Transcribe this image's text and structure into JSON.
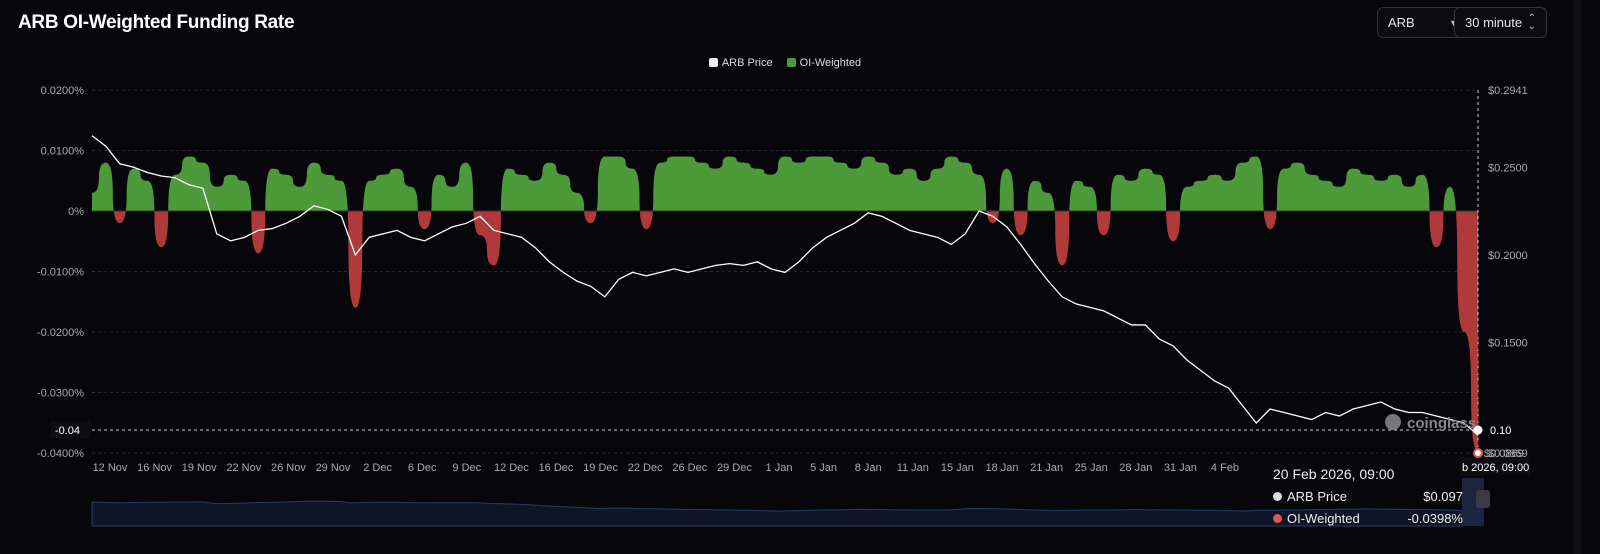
{
  "header": {
    "title": "ARB OI-Weighted Funding Rate",
    "coin_select": "ARB",
    "interval_select": "30 minute"
  },
  "colors": {
    "positive": "#4c9a3a",
    "negative": "#b03a3a",
    "price": "#ffffff",
    "navigator": "#2a3a6a"
  },
  "tooltip": {
    "date": "20 Feb 2026, 09:00",
    "rows": [
      {
        "label": "ARB Price",
        "value": "$0.097",
        "color": "#ffffff"
      },
      {
        "label": "OI-Weighted",
        "value": "-0.0398%",
        "color": "#e05555"
      }
    ]
  },
  "crosshair": {
    "left_label": "-0.04",
    "right_label": "0.10",
    "right_secondary": "$0.0869",
    "bottom_label": "b 2026, 09:00"
  },
  "watermark": "coinglass",
  "chart_data": {
    "type": "bar+line",
    "legend": [
      "ARB Price",
      "OI-Weighted"
    ],
    "legend_position": "top",
    "x_range": [
      "12 Nov 2025",
      "20 Feb 2026"
    ],
    "x_ticks": [
      "12 Nov",
      "16 Nov",
      "19 Nov",
      "22 Nov",
      "26 Nov",
      "29 Nov",
      "2 Dec",
      "6 Dec",
      "9 Dec",
      "12 Dec",
      "16 Dec",
      "19 Dec",
      "22 Dec",
      "26 Dec",
      "29 Dec",
      "1 Jan",
      "5 Jan",
      "8 Jan",
      "11 Jan",
      "15 Jan",
      "18 Jan",
      "21 Jan",
      "25 Jan",
      "28 Jan",
      "31 Jan",
      "4 Feb"
    ],
    "y_left": {
      "ticks": [
        "0.0200%",
        "0.0100%",
        "0%",
        "-0.0100%",
        "-0.0200%",
        "-0.0300%",
        "-0.0400%"
      ],
      "range": [
        -0.04,
        0.02
      ],
      "unit": "%"
    },
    "y_right": {
      "ticks": [
        "$0.2941",
        "$0.2500",
        "$0.2000",
        "$0.1500",
        "$0.1000",
        "$0.0869"
      ],
      "range": [
        0.0869,
        0.2941
      ]
    },
    "grid": true,
    "series": [
      {
        "name": "OI-Weighted",
        "type": "area",
        "values": [
          0.003,
          0.008,
          -0.002,
          0.007,
          0.005,
          -0.006,
          0.006,
          0.009,
          0.008,
          0.004,
          0.006,
          0.005,
          -0.007,
          0.007,
          0.006,
          0.004,
          0.008,
          0.006,
          0.005,
          -0.016,
          0.005,
          0.006,
          0.007,
          0.004,
          -0.003,
          0.006,
          0.004,
          0.008,
          -0.004,
          -0.009,
          0.007,
          0.006,
          0.005,
          0.008,
          0.006,
          0.003,
          -0.002,
          0.009,
          0.009,
          0.007,
          -0.003,
          0.008,
          0.009,
          0.009,
          0.008,
          0.007,
          0.009,
          0.008,
          0.007,
          0.006,
          0.009,
          0.008,
          0.009,
          0.009,
          0.008,
          0.007,
          0.009,
          0.008,
          0.006,
          0.007,
          0.005,
          0.007,
          0.009,
          0.008,
          0.006,
          -0.002,
          0.007,
          -0.004,
          0.005,
          0.003,
          -0.009,
          0.005,
          0.004,
          -0.004,
          0.006,
          0.005,
          0.007,
          0.006,
          -0.005,
          0.004,
          0.005,
          0.006,
          0.005,
          0.008,
          0.009,
          -0.003,
          0.007,
          0.008,
          0.006,
          0.005,
          0.004,
          0.007,
          0.006,
          0.005,
          0.006,
          0.004,
          0.006,
          -0.006,
          0.004,
          -0.02,
          -0.0398
        ]
      },
      {
        "name": "ARB Price",
        "type": "line",
        "values": [
          0.268,
          0.262,
          0.252,
          0.25,
          0.247,
          0.245,
          0.244,
          0.24,
          0.238,
          0.212,
          0.208,
          0.21,
          0.214,
          0.215,
          0.218,
          0.222,
          0.228,
          0.226,
          0.222,
          0.2,
          0.21,
          0.212,
          0.214,
          0.21,
          0.208,
          0.212,
          0.216,
          0.218,
          0.222,
          0.214,
          0.212,
          0.21,
          0.204,
          0.196,
          0.19,
          0.185,
          0.182,
          0.176,
          0.186,
          0.19,
          0.188,
          0.19,
          0.192,
          0.19,
          0.192,
          0.194,
          0.195,
          0.194,
          0.196,
          0.192,
          0.19,
          0.196,
          0.204,
          0.21,
          0.214,
          0.218,
          0.224,
          0.222,
          0.218,
          0.214,
          0.212,
          0.21,
          0.206,
          0.212,
          0.225,
          0.222,
          0.216,
          0.206,
          0.195,
          0.185,
          0.176,
          0.172,
          0.17,
          0.168,
          0.164,
          0.16,
          0.16,
          0.152,
          0.148,
          0.14,
          0.134,
          0.128,
          0.124,
          0.114,
          0.104,
          0.112,
          0.11,
          0.108,
          0.106,
          0.11,
          0.108,
          0.112,
          0.114,
          0.116,
          0.112,
          0.11,
          0.11,
          0.108,
          0.106,
          0.104,
          0.097
        ]
      }
    ]
  }
}
